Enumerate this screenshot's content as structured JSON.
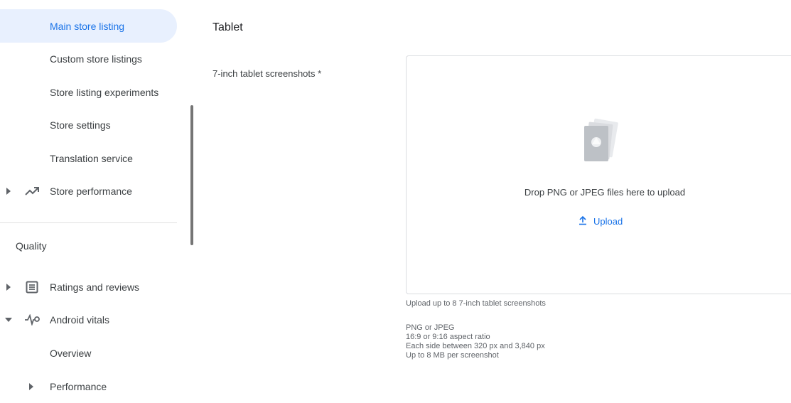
{
  "sidebar": {
    "items": [
      {
        "label": "Main store listing"
      },
      {
        "label": "Custom store listings"
      },
      {
        "label": "Store listing experiments"
      },
      {
        "label": "Store settings"
      },
      {
        "label": "Translation service"
      },
      {
        "label": "Store performance"
      }
    ],
    "section_heading": "Quality",
    "quality_items": [
      {
        "label": "Ratings and reviews"
      },
      {
        "label": "Android vitals"
      },
      {
        "label": "Overview"
      },
      {
        "label": "Performance"
      }
    ]
  },
  "main": {
    "title": "Tablet",
    "field_label": "7-inch tablet screenshots  *",
    "dropzone": {
      "text": "Drop PNG or JPEG files here to upload",
      "upload_label": "Upload"
    },
    "help": {
      "limit": "Upload up to 8 7-inch tablet screenshots",
      "line1": "PNG or JPEG",
      "line2": "16:9 or 9:16 aspect ratio",
      "line3": "Each side between 320 px and 3,840 px",
      "line4": "Up to 8 MB per screenshot"
    }
  },
  "colors": {
    "accent": "#1a73e8",
    "active_bg": "#e8f0fe"
  }
}
